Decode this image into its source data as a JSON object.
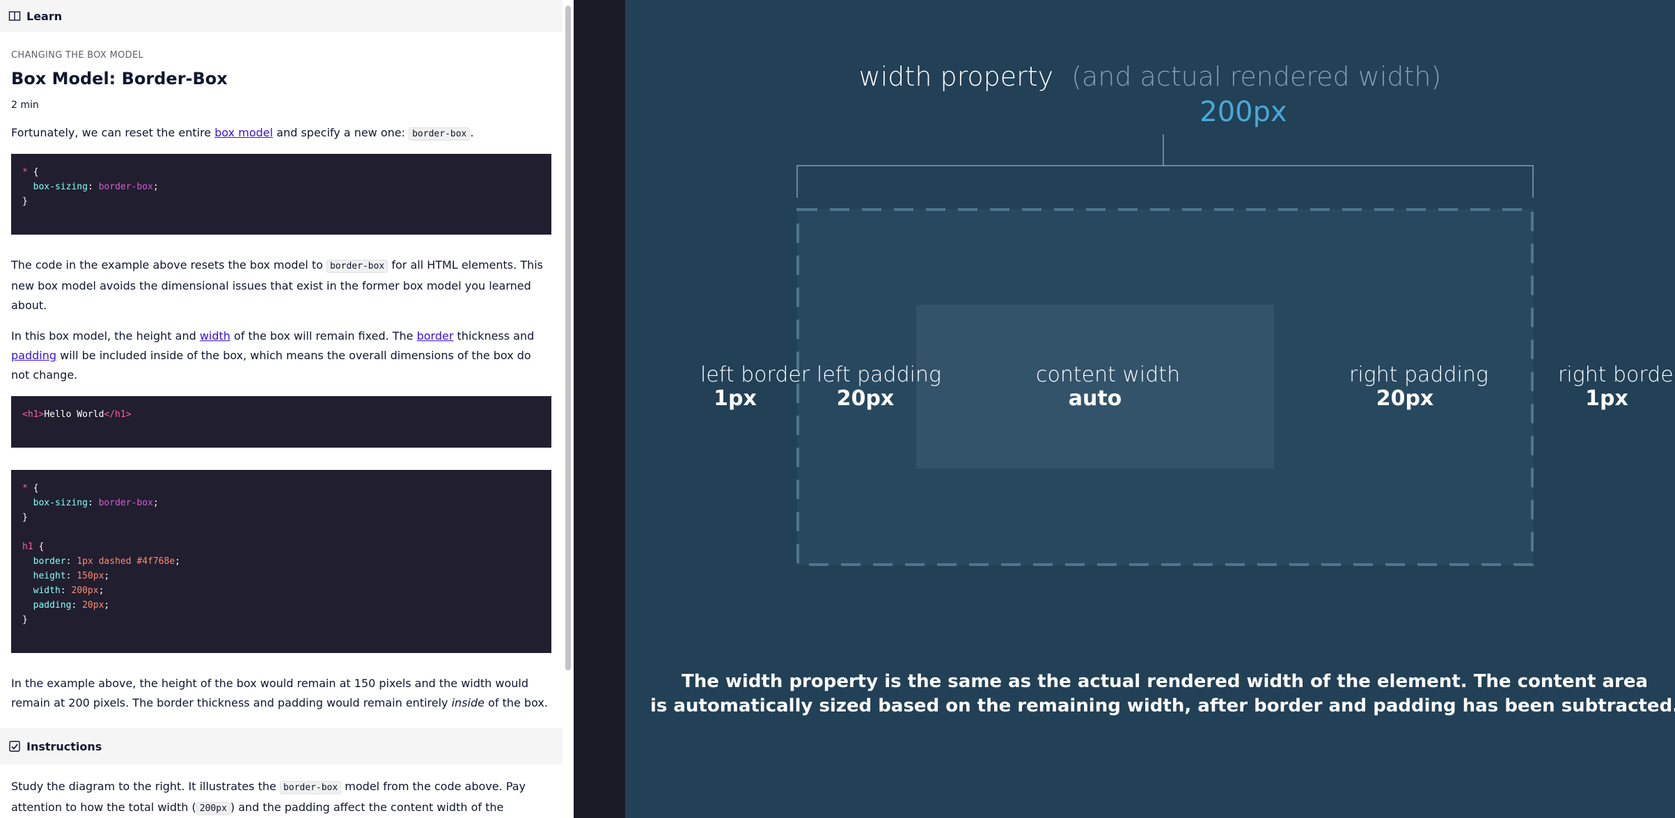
{
  "learn_header": {
    "label": "Learn",
    "icon": "book-icon"
  },
  "lesson": {
    "kicker": "CHANGING THE BOX MODEL",
    "title": "Box Model: Border-Box",
    "duration": "2 min"
  },
  "para1": {
    "before": "Fortunately, we can reset the entire ",
    "link": "box model",
    "middle": " and specify a new one: ",
    "code": "border-box",
    "after": "."
  },
  "code1": {
    "sel": "*",
    "open": " {",
    "prop": "box-sizing",
    "val": "border-box",
    "close": "}"
  },
  "para2": {
    "before": "The code in the example above resets the box model to ",
    "code": "border-box",
    "after": " for all HTML elements. This new box model avoids the dimensional issues that exist in the former box model you learned about."
  },
  "para3": {
    "t1": "In this box model, the height and ",
    "link1": "width",
    "t2": " of the box will remain fixed. The ",
    "link2": "border",
    "t3": " thickness and ",
    "link3": "padding",
    "t4": " will be included inside of the box, which means the overall dimensions of the box do not change."
  },
  "code2": {
    "open_tag": "<h1>",
    "text": "Hello World",
    "close_tag": "</h1>"
  },
  "code3": {
    "sel1": "*",
    "open": " {",
    "prop1": "box-sizing",
    "val1": "border-box",
    "close": "}",
    "sel2": "h1",
    "props": [
      {
        "name": "border",
        "value": "1px dashed #4f768e"
      },
      {
        "name": "height",
        "value": "150px"
      },
      {
        "name": "width",
        "value": "200px"
      },
      {
        "name": "padding",
        "value": "20px"
      }
    ]
  },
  "para4": {
    "before": "In the example above, the height of the box would remain at 150 pixels and the width would remain at 200 pixels. The border thickness and padding would remain entirely ",
    "em": "inside",
    "after": " of the box."
  },
  "instructions_header": {
    "label": "Instructions",
    "icon": "checkbox-icon"
  },
  "para5": {
    "before": "Study the diagram to the right. It illustrates the ",
    "code1": "border-box",
    "middle": " model from the code above. Pay attention to how the total width (",
    "code2": "200px",
    "after": ") and the padding affect the content width of the element."
  },
  "diagram": {
    "width_label": "width property",
    "width_note": "(and actual rendered width)",
    "width_value": "200px",
    "left_border": {
      "label": "left border",
      "value": "1px"
    },
    "left_padding": {
      "label": "left padding",
      "value": "20px"
    },
    "content_width": {
      "label": "content width",
      "value": "auto"
    },
    "right_padding": {
      "label": "right padding",
      "value": "20px"
    },
    "right_border": {
      "label": "right border",
      "value": "1px"
    },
    "caption_line1": "The width property is the same as the actual rendered width of the element. The content area",
    "caption_line2": "is automatically sized based on the remaining width, after border and padding has been subtracted.",
    "colors": {
      "background": "#224056",
      "box": "#284860",
      "content": "#33536b",
      "dashed_border": "#4f768e",
      "accent": "#4aa8d8",
      "muted": "#7f9fb4"
    }
  }
}
